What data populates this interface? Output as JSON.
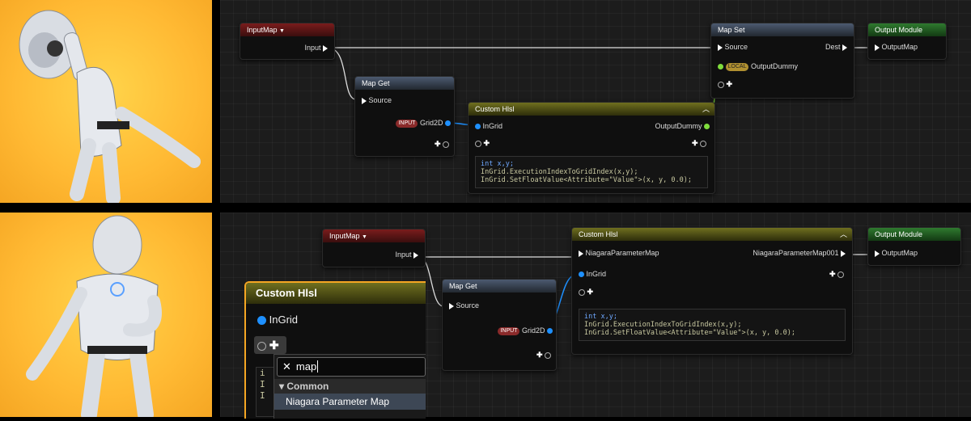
{
  "top": {
    "input_map": {
      "title": "InputMap",
      "pin_input": "Input"
    },
    "map_get": {
      "title": "Map Get",
      "pin_source": "Source",
      "grid_tag": "INPUT",
      "grid_label": "Grid2D"
    },
    "custom_hlsl": {
      "title": "Custom Hlsl",
      "pin_ingrid": "InGrid",
      "pin_output": "OutputDummy",
      "code_l1": "int x,y;",
      "code_l2": "InGrid.ExecutionIndexToGridIndex(x,y);",
      "code_l3": "InGrid.SetFloatValue<Attribute=\"Value\">(x, y, 0.0);"
    },
    "map_set": {
      "title": "Map Set",
      "pin_source": "Source",
      "pin_dest": "Dest",
      "local_tag": "LOCAL",
      "local_label": "OutputDummy"
    },
    "output_module": {
      "title": "Output Module",
      "pin": "OutputMap"
    }
  },
  "bottom": {
    "input_map": {
      "title": "InputMap",
      "pin_input": "Input"
    },
    "custom_hlsl": {
      "title": "Custom Hlsl",
      "pin_param": "NiagaraParameterMap",
      "pin_param_out": "NiagaraParameterMap001",
      "pin_ingrid": "InGrid",
      "code_l1": "int x,y;",
      "code_l2": "InGrid.ExecutionIndexToGridIndex(x,y);",
      "code_l3": "InGrid.SetFloatValue<Attribute=\"Value\">(x, y, 0.0);"
    },
    "map_get": {
      "title": "Map Get",
      "pin_source": "Source",
      "grid_tag": "INPUT",
      "grid_label": "Grid2D"
    },
    "output_module": {
      "title": "Output Module",
      "pin": "OutputMap"
    },
    "zoom_panel": {
      "title": "Custom Hlsl",
      "pin_ingrid": "InGrid",
      "search_value": "map",
      "category": "Common",
      "result": "Niagara Parameter Map",
      "code_peek": "i\nI\nI"
    }
  },
  "colors": {
    "exec": "#ffffff",
    "grid_pin": "#1e90ff",
    "green_pin": "#7fdc3c",
    "accent_orange": "#f5a623"
  }
}
